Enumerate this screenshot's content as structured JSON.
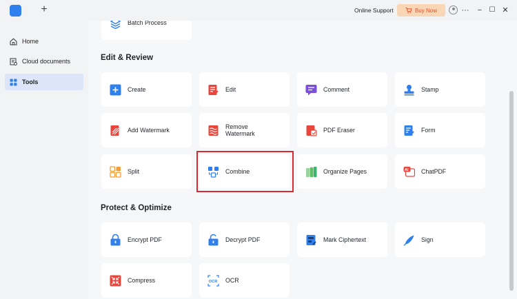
{
  "titlebar": {
    "new_tab": "+",
    "online_support": "Online Support",
    "buy_now": "Buy Now",
    "more": "···",
    "minimize": "−",
    "maximize": "☐",
    "close": "✕"
  },
  "sidebar": {
    "items": [
      {
        "label": "Home",
        "icon": "home-icon"
      },
      {
        "label": "Cloud documents",
        "icon": "cloud-doc-icon"
      },
      {
        "label": "Tools",
        "icon": "tools-grid-icon",
        "active": true
      }
    ]
  },
  "main": {
    "top_partial_card": {
      "label": "Batch Process",
      "icon": "batch-layers-icon"
    },
    "sections": [
      {
        "title": "Edit & Review",
        "tools": [
          {
            "label": "Create",
            "icon": "create-plus-icon"
          },
          {
            "label": "Edit",
            "icon": "edit-doc-icon"
          },
          {
            "label": "Comment",
            "icon": "comment-icon"
          },
          {
            "label": "Stamp",
            "icon": "stamp-icon"
          },
          {
            "label": "Add Watermark",
            "icon": "add-watermark-icon"
          },
          {
            "label": "Remove Watermark",
            "icon": "remove-watermark-icon"
          },
          {
            "label": "PDF Eraser",
            "icon": "pdf-eraser-icon"
          },
          {
            "label": "Form",
            "icon": "form-icon"
          },
          {
            "label": "Split",
            "icon": "split-icon"
          },
          {
            "label": "Combine",
            "icon": "combine-icon",
            "highlighted": true
          },
          {
            "label": "Organize Pages",
            "icon": "organize-pages-icon"
          },
          {
            "label": "ChatPDF",
            "icon": "chatpdf-ai-icon"
          }
        ]
      },
      {
        "title": "Protect & Optimize",
        "tools": [
          {
            "label": "Encrypt PDF",
            "icon": "encrypt-lock-icon"
          },
          {
            "label": "Decrypt PDF",
            "icon": "decrypt-unlock-icon"
          },
          {
            "label": "Mark Ciphertext",
            "icon": "mark-ciphertext-icon"
          },
          {
            "label": "Sign",
            "icon": "sign-pen-icon"
          },
          {
            "label": "Compress",
            "icon": "compress-icon"
          },
          {
            "label": "OCR",
            "icon": "ocr-icon"
          }
        ]
      }
    ]
  },
  "colors": {
    "accent_blue": "#2f80ed",
    "red": "#e8453c",
    "purple": "#7b4fd6",
    "orange": "#f39c3a",
    "green": "#3cb371",
    "highlight_border": "#d9282f",
    "buy_now_bg": "#f9d6b5"
  }
}
